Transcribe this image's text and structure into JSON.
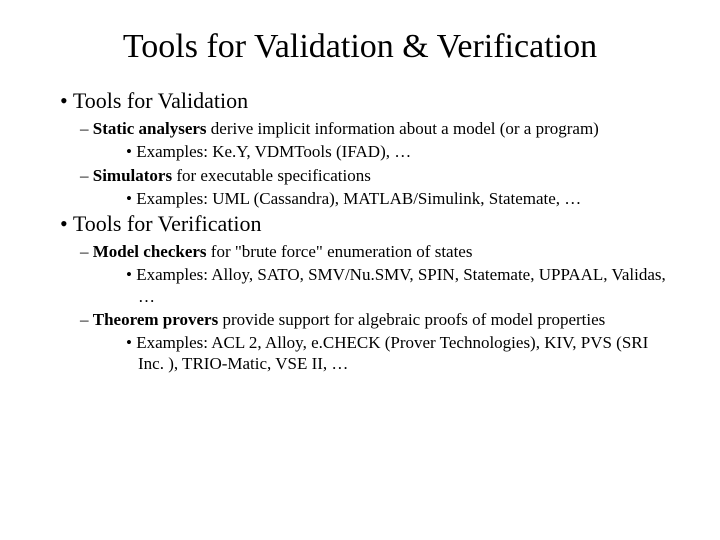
{
  "title": "Tools for Validation & Verification",
  "section1": {
    "heading": "Tools for Validation",
    "item1_lead": "Static analysers",
    "item1_rest": " derive implicit information about a model (or a program)",
    "item1_ex": "Examples: Ke.Y, VDMTools (IFAD), …",
    "item2_lead": "Simulators",
    "item2_rest": " for executable specifications",
    "item2_ex": "Examples: UML (Cassandra), MATLAB/Simulink, Statemate, …"
  },
  "section2": {
    "heading": "Tools for Verification",
    "item1_lead": "Model checkers",
    "item1_rest": " for \"brute force\" enumeration of states",
    "item1_ex": "Examples: Alloy, SATO, SMV/Nu.SMV, SPIN, Statemate, UPPAAL, Validas, …",
    "item2_lead": "Theorem provers",
    "item2_rest": " provide support for algebraic proofs of model properties",
    "item2_ex": "Examples: ACL 2, Alloy, e.CHECK (Prover Technologies), KIV, PVS (SRI Inc. ), TRIO-Matic, VSE II, …"
  }
}
